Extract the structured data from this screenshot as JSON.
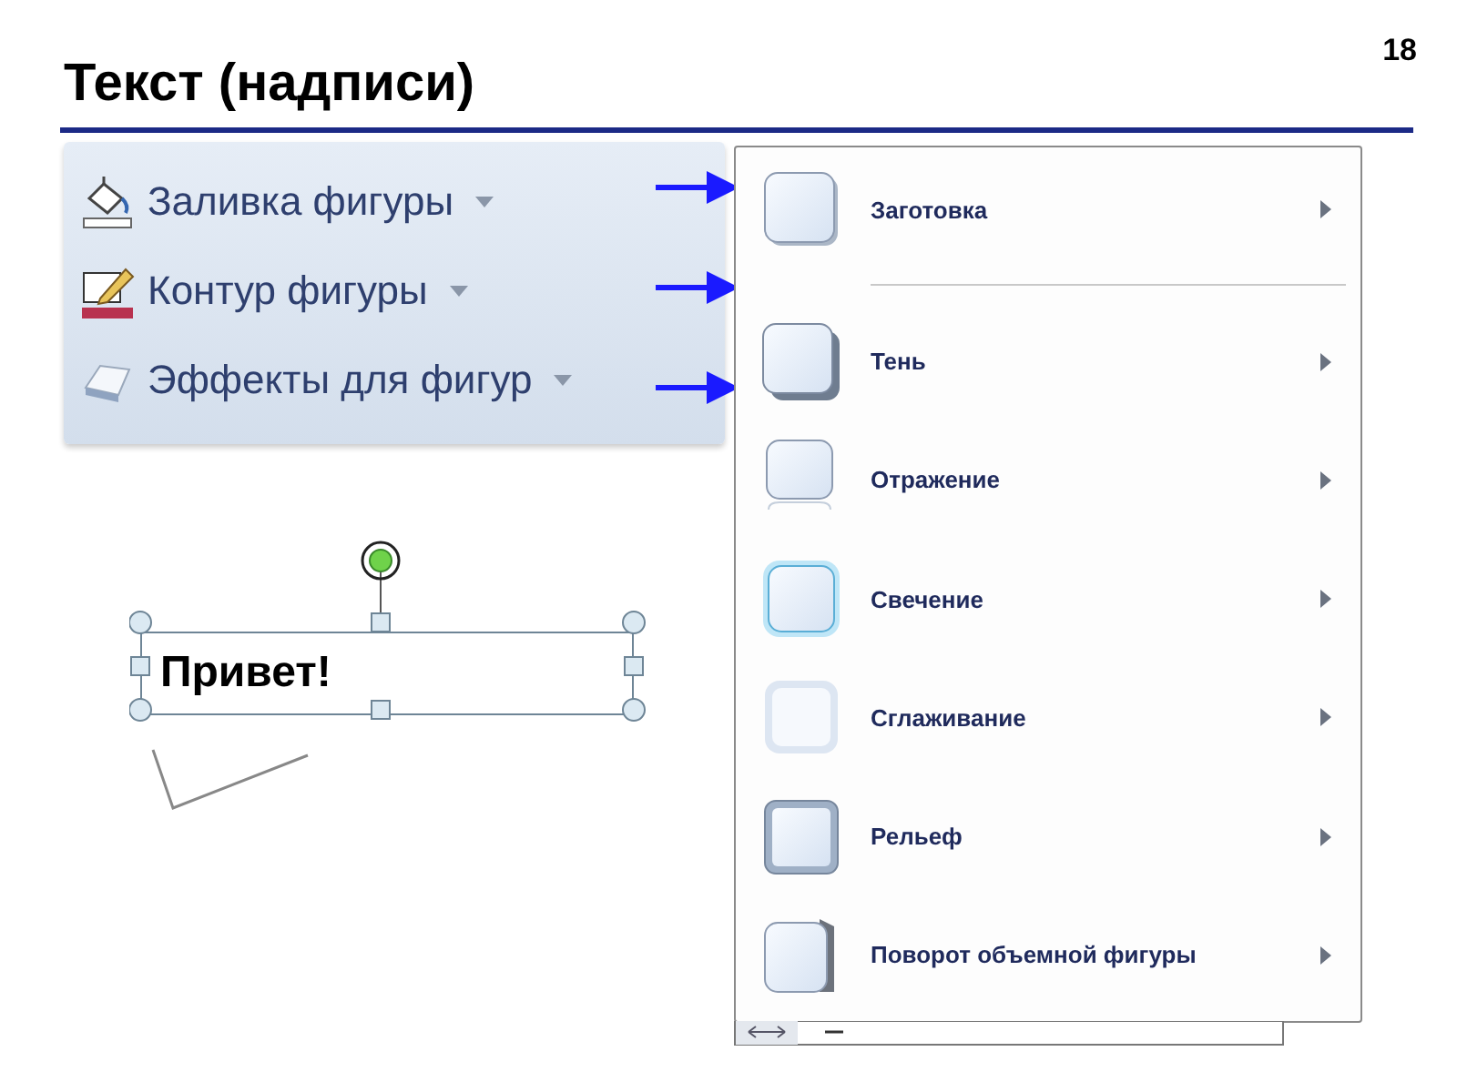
{
  "slide": {
    "number": "18",
    "title": "Текст (надписи)"
  },
  "ribbon": {
    "buttons": [
      {
        "label": "Заливка фигуры",
        "kind": "fill"
      },
      {
        "label": "Контур фигуры",
        "kind": "outline"
      },
      {
        "label": "Эффекты для фигур",
        "kind": "effects"
      }
    ]
  },
  "menu": {
    "items": [
      {
        "label": "Заготовка",
        "kind": "preset"
      },
      {
        "label": "Тень",
        "kind": "shadow"
      },
      {
        "label": "Отражение",
        "kind": "reflection"
      },
      {
        "label": "Свечение",
        "kind": "glow"
      },
      {
        "label": "Сглаживание",
        "kind": "soft"
      },
      {
        "label": "Рельеф",
        "kind": "bevel"
      },
      {
        "label": "Поворот объемной фигуры",
        "kind": "rotation"
      }
    ]
  },
  "textbox": {
    "text": "Привет!"
  }
}
